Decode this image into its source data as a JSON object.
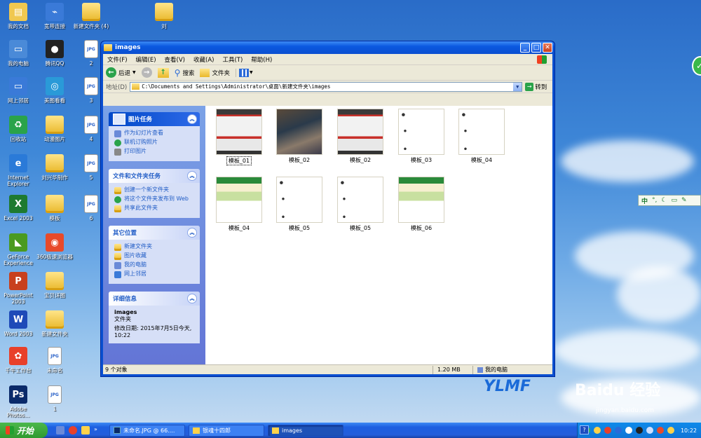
{
  "desktop": {
    "icons": [
      {
        "label": "我的文档",
        "glyph": "▤",
        "color": "#f0c850"
      },
      {
        "label": "宽带连接",
        "glyph": "⌁",
        "color": "#3a7ad8"
      },
      {
        "label": "新建文件夹 (4)",
        "glyph": "",
        "color": "folder"
      },
      {
        "label": "刘",
        "glyph": "",
        "color": "folder"
      },
      {
        "label": "我的电脑",
        "glyph": "▭",
        "color": "#4a8ad8"
      },
      {
        "label": "腾讯QQ",
        "glyph": "●",
        "color": "#222222"
      },
      {
        "label": "2",
        "glyph": "JPG",
        "color": "doc"
      },
      {
        "label": "网上邻居",
        "glyph": "▭",
        "color": "#3a7ad8"
      },
      {
        "label": "美图看看",
        "glyph": "◎",
        "color": "#2a9ad8"
      },
      {
        "label": "3",
        "glyph": "JPG",
        "color": "doc"
      },
      {
        "label": "回收站",
        "glyph": "♻",
        "color": "#2aa34a"
      },
      {
        "label": "动漫图片",
        "glyph": "",
        "color": "folder"
      },
      {
        "label": "4",
        "glyph": "JPG",
        "color": "doc"
      },
      {
        "label": "Internet Explorer",
        "glyph": "e",
        "color": "#2a7ad8"
      },
      {
        "label": "刘兴华制作",
        "glyph": "",
        "color": "folder"
      },
      {
        "label": "5",
        "glyph": "JPG",
        "color": "doc"
      },
      {
        "label": "Excel 2003",
        "glyph": "X",
        "color": "#1e7a30"
      },
      {
        "label": "模板",
        "glyph": "",
        "color": "folder"
      },
      {
        "label": "6",
        "glyph": "JPG",
        "color": "doc"
      },
      {
        "label": "GeForce Experience",
        "glyph": "◣",
        "color": "#4a9a20"
      },
      {
        "label": "360极速浏览器",
        "glyph": "◉",
        "color": "#e84a2a"
      },
      {
        "label": "PowerPoint 2003",
        "glyph": "P",
        "color": "#c8401e"
      },
      {
        "label": "宝贝详图",
        "glyph": "",
        "color": "folder"
      },
      {
        "label": "Word 2003",
        "glyph": "W",
        "color": "#1e4ab8"
      },
      {
        "label": "新建文件夹",
        "glyph": "",
        "color": "folder"
      },
      {
        "label": "千牛工作台",
        "glyph": "✿",
        "color": "#e8402a"
      },
      {
        "label": "未命名",
        "glyph": "JPG",
        "color": "doc"
      },
      {
        "label": "Adobe Photos...",
        "glyph": "Ps",
        "color": "#0a2a6a"
      },
      {
        "label": "1",
        "glyph": "JPG",
        "color": "doc"
      }
    ]
  },
  "window": {
    "title": "images",
    "menu": [
      "文件(F)",
      "编辑(E)",
      "查看(V)",
      "收藏(A)",
      "工具(T)",
      "帮助(H)"
    ],
    "toolbar": {
      "back": "后退",
      "search": "搜索",
      "folders": "文件夹"
    },
    "address": {
      "label": "地址(D)",
      "value": "C:\\Documents and Settings\\Administrator\\桌面\\新建文件夹\\images",
      "go": "转到"
    },
    "panels": [
      {
        "title": "图片任务",
        "links": [
          "作为幻灯片查看",
          "联机订购照片",
          "打印图片"
        ]
      },
      {
        "title": "文件和文件夹任务",
        "links": [
          "创建一个新文件夹",
          "将这个文件夹发布到 Web",
          "共享此文件夹"
        ]
      },
      {
        "title": "其它位置",
        "links": [
          "新建文件夹",
          "图片收藏",
          "我的电脑",
          "网上邻居"
        ]
      }
    ],
    "details": {
      "title": "详细信息",
      "name": "images",
      "type": "文件夹",
      "modified": "修改日期: 2015年7月5日今天, 10:22"
    },
    "files": [
      "模板_01",
      "模板_02",
      "模板_02",
      "模板_03",
      "模板_04",
      "模板_04",
      "模板_05",
      "模板_05",
      "模板_06"
    ],
    "status": {
      "count": "9 个对象",
      "size": "1.20 MB",
      "location": "我的电脑"
    }
  },
  "taskbar": {
    "start": "开始",
    "tasks": [
      "未命名.JPG @ 66....",
      "银魂十四郎",
      "images"
    ],
    "help": "?",
    "clock": "10:22"
  },
  "ime": {
    "label": "中"
  },
  "watermark": {
    "brand": "YLMF",
    "baidu": "Baidu 经验",
    "url": "jingyan.baidu.com"
  }
}
